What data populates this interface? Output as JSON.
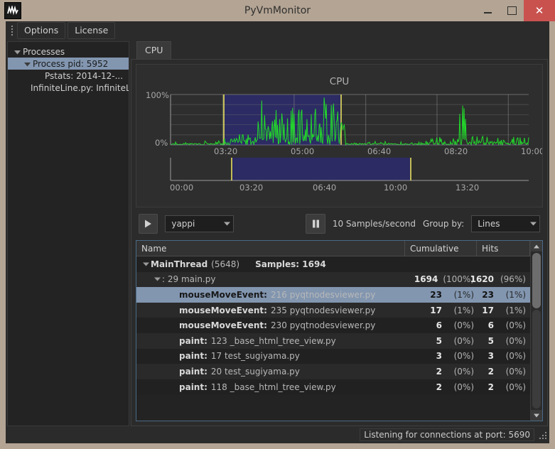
{
  "window": {
    "title": "PyVmMonitor",
    "logo_icon": "waveform-logo-icon",
    "minimize_label": "",
    "maximize_label": "",
    "close_label": "✕"
  },
  "menubar": {
    "grip_icon": "drag-handle-icon",
    "items": [
      {
        "label": "Options"
      },
      {
        "label": "License"
      }
    ]
  },
  "sidebar": {
    "tree": [
      {
        "label": "Processes",
        "indent": 0,
        "expanded": true,
        "selected": false
      },
      {
        "label": "Process pid: 5952",
        "indent": 1,
        "expanded": true,
        "selected": true
      },
      {
        "label": "Pstats: 2014-12-...",
        "indent": 2,
        "expanded": false,
        "selected": false
      },
      {
        "label": "InfiniteLine.py: InfiniteL...",
        "indent": 0,
        "leaf": true,
        "selected": false
      }
    ]
  },
  "tabs": [
    {
      "label": "CPU",
      "active": true
    }
  ],
  "chart_data": {
    "type": "line",
    "title": "CPU",
    "xlabel": "",
    "ylabel": "",
    "ylim": [
      0,
      100
    ],
    "ytick_labels": [
      "100%",
      "0%"
    ],
    "xtick_labels": [
      "03:20",
      "05:00",
      "06:40",
      "08:20",
      "10:00"
    ],
    "grid": true,
    "series_color": "#22d92b",
    "selection_fill": "#2c2b63",
    "selection_edge": "#e8e05a",
    "selection_start_label": "03:20",
    "selection_end_label": "06:15",
    "overview": {
      "xtick_labels": [
        "00:00",
        "03:20",
        "06:40",
        "10:00",
        "13:20"
      ],
      "selection_fill": "#2c2b63",
      "selection_edge": "#e8e05a"
    }
  },
  "controls": {
    "play_icon": "play-icon",
    "pause_icon": "pause-icon",
    "profiler": {
      "value": "yappi",
      "arrow_icon": "chevron-down-icon"
    },
    "samples_text": "10 Samples/second",
    "group_by_label": "Group by:",
    "group_by": {
      "value": "Lines",
      "arrow_icon": "chevron-down-icon"
    }
  },
  "table": {
    "headers": {
      "name": "Name",
      "cumulative": "Cumulative",
      "hits": "Hits"
    },
    "rows": [
      {
        "indent": 0,
        "twisty": "expanded",
        "selected": false,
        "bold_part": "MainThread",
        "dim_part": "(5648)",
        "extra": "Samples: 1694",
        "cum": "",
        "cum_pct": "",
        "hits": "",
        "hits_pct": ""
      },
      {
        "indent": 1,
        "twisty": "expanded",
        "selected": false,
        "bold_part": "",
        "dim_part": ": 29 main.py",
        "extra": "",
        "cum": "1694",
        "cum_pct": "(100%)",
        "hits": "1620",
        "hits_pct": "(96%)"
      },
      {
        "indent": 2,
        "twisty": "none",
        "selected": true,
        "bold_part": "mouseMoveEvent:",
        "dim_part": "216 pyqtnodesviewer.py",
        "extra": "",
        "cum": "23",
        "cum_pct": "(1%)",
        "hits": "23",
        "hits_pct": "(1%)"
      },
      {
        "indent": 2,
        "twisty": "none",
        "selected": false,
        "bold_part": "mouseMoveEvent:",
        "dim_part": "235 pyqtnodesviewer.py",
        "extra": "",
        "cum": "17",
        "cum_pct": "(1%)",
        "hits": "17",
        "hits_pct": "(1%)"
      },
      {
        "indent": 2,
        "twisty": "none",
        "selected": false,
        "bold_part": "mouseMoveEvent:",
        "dim_part": "230 pyqtnodesviewer.py",
        "extra": "",
        "cum": "6",
        "cum_pct": "(0%)",
        "hits": "6",
        "hits_pct": "(0%)"
      },
      {
        "indent": 2,
        "twisty": "none",
        "selected": false,
        "bold_part": "paint:",
        "dim_part": "123 _base_html_tree_view.py",
        "extra": "",
        "cum": "5",
        "cum_pct": "(0%)",
        "hits": "5",
        "hits_pct": "(0%)"
      },
      {
        "indent": 2,
        "twisty": "none",
        "selected": false,
        "bold_part": "paint:",
        "dim_part": "17 test_sugiyama.py",
        "extra": "",
        "cum": "3",
        "cum_pct": "(0%)",
        "hits": "3",
        "hits_pct": "(0%)"
      },
      {
        "indent": 2,
        "twisty": "none",
        "selected": false,
        "bold_part": "paint:",
        "dim_part": "20 test_sugiyama.py",
        "extra": "",
        "cum": "2",
        "cum_pct": "(0%)",
        "hits": "2",
        "hits_pct": "(0%)"
      },
      {
        "indent": 2,
        "twisty": "none",
        "selected": false,
        "bold_part": "paint:",
        "dim_part": "118 _base_html_tree_view.py",
        "extra": "",
        "cum": "2",
        "cum_pct": "(0%)",
        "hits": "2",
        "hits_pct": "(0%)"
      }
    ]
  },
  "statusbar": {
    "text": "Listening for connections at port: 5690",
    "grip_icon": "resize-grip-icon"
  }
}
